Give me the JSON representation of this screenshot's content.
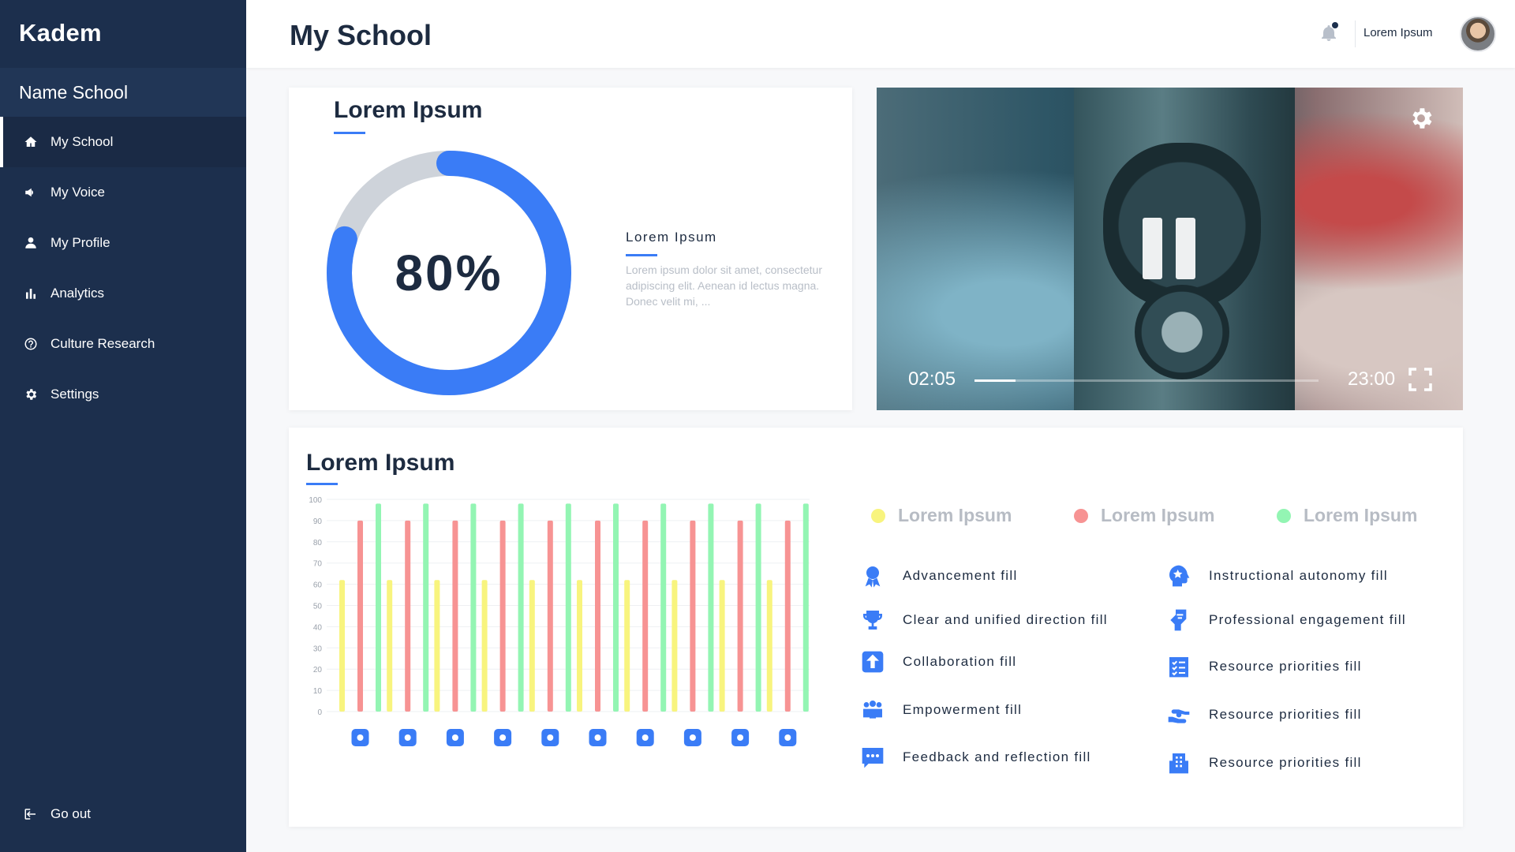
{
  "sidebar": {
    "brand": "Kadem",
    "school": "Name School",
    "items": [
      {
        "label": "My School",
        "icon": "home-icon",
        "active": true
      },
      {
        "label": "My Voice",
        "icon": "megaphone-icon"
      },
      {
        "label": "My Profile",
        "icon": "user-icon"
      },
      {
        "label": "Analytics",
        "icon": "bar-chart-icon"
      },
      {
        "label": "Culture Research",
        "icon": "help-circle-icon"
      },
      {
        "label": "Settings",
        "icon": "gear-icon"
      }
    ],
    "logout": "Go out"
  },
  "header": {
    "title": "My School",
    "user": "Lorem Ipsum"
  },
  "summary": {
    "title": "Lorem Ipsum",
    "percent_label": "80%",
    "percent_value": 80,
    "side_title": "Lorem Ipsum",
    "side_text": "Lorem ipsum dolor sit amet, consectetur adipiscing elit. Aenean id lectus magna. Donec velit mi, ..."
  },
  "video": {
    "current_time": "02:05",
    "duration": "23:00",
    "progress": 0.12
  },
  "analysis": {
    "title": "Lorem Ipsum",
    "legend": [
      {
        "label": "Lorem Ipsum",
        "color": "#f8f47e"
      },
      {
        "label": "Lorem Ipsum",
        "color": "#f79393"
      },
      {
        "label": "Lorem Ipsum",
        "color": "#93f5b3"
      }
    ],
    "features_left": [
      {
        "label": "Advancement fill",
        "icon": "award-icon"
      },
      {
        "label": "Clear and unified direction fill",
        "icon": "trophy-icon"
      },
      {
        "label": "Collaboration fill",
        "icon": "upload-icon"
      },
      {
        "label": "Empowerment fill",
        "icon": "group-icon"
      },
      {
        "label": "Feedback and reflection fill",
        "icon": "chat-icon"
      }
    ],
    "features_right": [
      {
        "label": "Instructional autonomy fill",
        "icon": "star-head-icon"
      },
      {
        "label": "Professional engagement fill",
        "icon": "handshake-icon"
      },
      {
        "label": "Resource priorities fill",
        "icon": "checklist-icon"
      },
      {
        "label": "Resource priorities fill",
        "icon": "hand-care-icon"
      },
      {
        "label": "Resource priorities fill",
        "icon": "building-icon"
      }
    ]
  },
  "chart_data": {
    "type": "bar",
    "categories": [
      "award-icon",
      "trophy-icon",
      "upload-icon",
      "group-icon",
      "chat-icon",
      "star-head-icon",
      "handshake-icon",
      "checklist-icon",
      "hand-care-icon",
      "building-icon"
    ],
    "series": [
      {
        "values": [
          62,
          62,
          62,
          62,
          62,
          62,
          62,
          62,
          62,
          62
        ],
        "color": "#f8f47e"
      },
      {
        "values": [
          90,
          90,
          90,
          90,
          90,
          90,
          90,
          90,
          90,
          90
        ],
        "color": "#f79393"
      },
      {
        "values": [
          98,
          98,
          98,
          98,
          98,
          98,
          98,
          98,
          98,
          98
        ],
        "color": "#93f5b3"
      }
    ],
    "yticks": [
      0,
      10,
      20,
      30,
      40,
      50,
      60,
      70,
      80,
      90,
      100
    ],
    "ylim": [
      0,
      100
    ],
    "grid": true
  }
}
